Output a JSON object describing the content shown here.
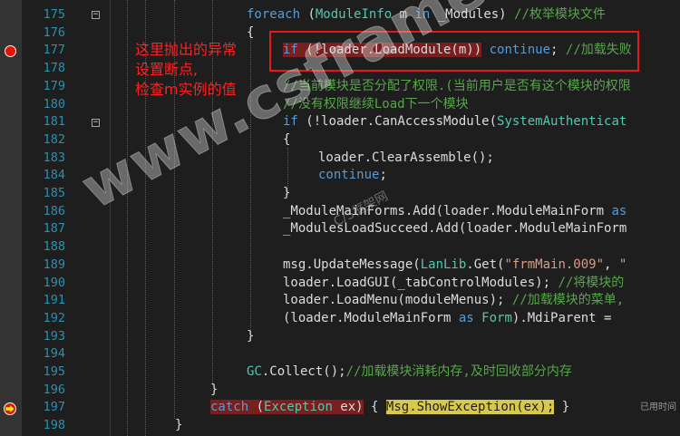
{
  "editor": {
    "lines": [
      {
        "num": "175",
        "tokens": [
          {
            "t": "foreach",
            "c": "kw"
          },
          {
            "t": " (",
            "c": ""
          },
          {
            "t": "ModuleInfo",
            "c": "ty"
          },
          {
            "t": " m ",
            "c": ""
          },
          {
            "t": "in",
            "c": "kw"
          },
          {
            "t": " _Modules) ",
            "c": ""
          },
          {
            "t": "//枚举模块文件",
            "c": "cm"
          }
        ]
      },
      {
        "num": "176",
        "tokens": [
          {
            "t": "{",
            "c": ""
          }
        ]
      },
      {
        "num": "177",
        "tokens": [
          {
            "t": "if",
            "c": "kw hl-red"
          },
          {
            "t": " (!loader.LoadModule(m))",
            "c": "hl-red"
          },
          {
            "t": " ",
            "c": ""
          },
          {
            "t": "continue",
            "c": "kw"
          },
          {
            "t": "; ",
            "c": ""
          },
          {
            "t": "//加载失败",
            "c": "cm"
          }
        ]
      },
      {
        "num": "178",
        "tokens": []
      },
      {
        "num": "179",
        "tokens": [
          {
            "t": "//当前模块是否分配了权限.(当前用户是否有这个模块的权限",
            "c": "cm"
          }
        ]
      },
      {
        "num": "180",
        "tokens": [
          {
            "t": "//没有权限继续Load下一个模块",
            "c": "cm"
          }
        ]
      },
      {
        "num": "181",
        "tokens": [
          {
            "t": "if",
            "c": "kw"
          },
          {
            "t": " (!loader.CanAccessModule(",
            "c": ""
          },
          {
            "t": "SystemAuthenticat",
            "c": "ty"
          }
        ]
      },
      {
        "num": "182",
        "tokens": [
          {
            "t": "{",
            "c": ""
          }
        ]
      },
      {
        "num": "183",
        "tokens": [
          {
            "t": "loader.ClearAssemble();",
            "c": ""
          }
        ]
      },
      {
        "num": "184",
        "tokens": [
          {
            "t": "continue",
            "c": "kw"
          },
          {
            "t": ";",
            "c": ""
          }
        ]
      },
      {
        "num": "185",
        "tokens": [
          {
            "t": "}",
            "c": ""
          }
        ]
      },
      {
        "num": "186",
        "tokens": [
          {
            "t": "_ModuleMainForms.Add(loader.ModuleMainForm ",
            "c": ""
          },
          {
            "t": "as",
            "c": "kw"
          }
        ]
      },
      {
        "num": "187",
        "tokens": [
          {
            "t": "_ModulesLoadSucceed.Add(loader.ModuleMainForm",
            "c": ""
          }
        ]
      },
      {
        "num": "188",
        "tokens": []
      },
      {
        "num": "189",
        "tokens": [
          {
            "t": "msg.UpdateMessage(",
            "c": ""
          },
          {
            "t": "LanLib",
            "c": "ty"
          },
          {
            "t": ".Get(",
            "c": ""
          },
          {
            "t": "\"frmMain.009\"",
            "c": "st"
          },
          {
            "t": ", ",
            "c": ""
          },
          {
            "t": "\"",
            "c": "st"
          }
        ]
      },
      {
        "num": "190",
        "tokens": [
          {
            "t": "loader.LoadGUI(_tabControlModules); ",
            "c": ""
          },
          {
            "t": "//将模块的",
            "c": "cm"
          }
        ]
      },
      {
        "num": "191",
        "tokens": [
          {
            "t": "loader.LoadMenu(moduleMenus); ",
            "c": ""
          },
          {
            "t": "//加载模块的菜单,",
            "c": "cm"
          }
        ]
      },
      {
        "num": "192",
        "tokens": [
          {
            "t": "(loader.ModuleMainForm ",
            "c": ""
          },
          {
            "t": "as",
            "c": "kw"
          },
          {
            "t": " ",
            "c": ""
          },
          {
            "t": "Form",
            "c": "ty"
          },
          {
            "t": ").MdiParent = ",
            "c": ""
          }
        ]
      },
      {
        "num": "193",
        "tokens": [
          {
            "t": "}",
            "c": ""
          }
        ]
      },
      {
        "num": "194",
        "tokens": []
      },
      {
        "num": "195",
        "tokens": [
          {
            "t": "GC",
            "c": "ty"
          },
          {
            "t": ".Collect();",
            "c": ""
          },
          {
            "t": "//加载模块消耗内存,及时回收部分内存",
            "c": "cm"
          }
        ]
      },
      {
        "num": "196",
        "tokens": [
          {
            "t": "}",
            "c": ""
          }
        ]
      },
      {
        "num": "197",
        "tokens": [
          {
            "t": "catch",
            "c": "kw hl-red"
          },
          {
            "t": " (",
            "c": "hl-red"
          },
          {
            "t": "Exception",
            "c": "ty hl-red"
          },
          {
            "t": " ex)",
            "c": "hl-red"
          },
          {
            "t": " { ",
            "c": ""
          },
          {
            "t": "Msg",
            "c": "ty hl-yellow"
          },
          {
            "t": ".ShowException(ex);",
            "c": "hl-yellow"
          },
          {
            "t": " }",
            "c": ""
          }
        ]
      },
      {
        "num": "198",
        "tokens": [
          {
            "t": "}",
            "c": ""
          }
        ]
      }
    ],
    "perf_hint": "已用时间"
  },
  "annotation": {
    "lines": [
      "这里抛出的异常",
      "设置断点,",
      "检查m实例的值"
    ]
  },
  "watermark": {
    "main": "www.csframework.com",
    "sub": "C/S框架网"
  },
  "colors": {
    "background": "#1e1e1e",
    "line_number": "#2b91af",
    "keyword": "#569cd6",
    "type": "#4ec9b0",
    "comment": "#57a64a",
    "string": "#d69d85",
    "breakpoint": "#e51400",
    "annotation": "#ff2020",
    "current_statement": "#d8c94d"
  }
}
